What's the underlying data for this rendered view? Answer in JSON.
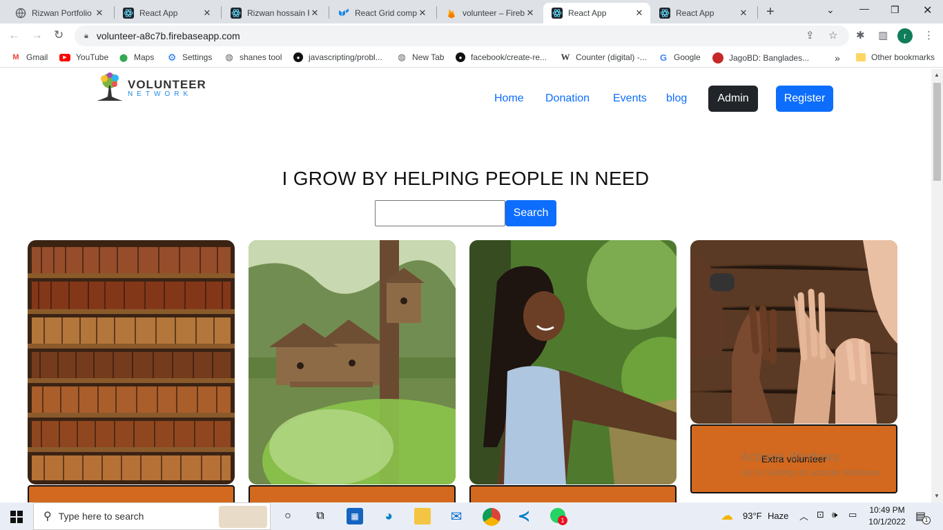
{
  "browser": {
    "tabs": [
      {
        "title": "Rizwan Portfolio W",
        "active": false
      },
      {
        "title": "React App",
        "active": false
      },
      {
        "title": "Rizwan hossain Re",
        "active": false
      },
      {
        "title": "React Grid compo",
        "active": false
      },
      {
        "title": "volunteer – Fireba",
        "active": false
      },
      {
        "title": "React App",
        "active": true
      },
      {
        "title": "React App",
        "active": false
      }
    ],
    "url": "volunteer-a8c7b.firebaseapp.com",
    "profile_initial": "r",
    "bookmarks": [
      {
        "label": "Gmail",
        "icon": "gmail-icon"
      },
      {
        "label": "YouTube",
        "icon": "youtube-icon"
      },
      {
        "label": "Maps",
        "icon": "maps-icon"
      },
      {
        "label": "Settings",
        "icon": "gear-icon"
      },
      {
        "label": "shanes tool",
        "icon": "globe-icon"
      },
      {
        "label": "javascripting/probl...",
        "icon": "github-icon"
      },
      {
        "label": "New Tab",
        "icon": "globe-icon"
      },
      {
        "label": "facebook/create-re...",
        "icon": "github-icon"
      },
      {
        "label": "Counter (digital) -...",
        "icon": "wikipedia-icon"
      },
      {
        "label": "Google",
        "icon": "google-icon"
      },
      {
        "label": "JagoBD: Banglades...",
        "icon": "jagobd-icon"
      }
    ],
    "overflow_label": "»",
    "other_bookmarks": "Other bookmarks"
  },
  "site": {
    "logo": {
      "line1": "VOLUNTEER",
      "line2": "NETWORK"
    },
    "nav": [
      {
        "label": "Home"
      },
      {
        "label": "Donation"
      },
      {
        "label": "Events"
      },
      {
        "label": "blog"
      }
    ],
    "admin_label": "Admin",
    "register_label": "Register",
    "headline": "I GROW BY HELPING PEOPLE IN NEED",
    "search": {
      "value": "",
      "button_label": "Search"
    },
    "cards": [
      {
        "image": "bookshelf-photo",
        "label": ""
      },
      {
        "image": "birdhouse-photo",
        "label": ""
      },
      {
        "image": "girl-smiling-photo",
        "label": ""
      },
      {
        "image": "hands-on-table-photo",
        "label": "Extra volunteer"
      }
    ],
    "card_footer_color": "#d2691e",
    "accent": "#0d6efd"
  },
  "windows": {
    "watermark_title": "Activate Windows",
    "watermark_sub": "Go to Settings to activate Windows.",
    "search_placeholder": "Type here to search",
    "weather_temp": "93°F",
    "weather_desc": "Haze",
    "time": "10:49 PM",
    "date": "10/1/2022",
    "whatsapp_badge": "1",
    "notification_badge": "1"
  }
}
